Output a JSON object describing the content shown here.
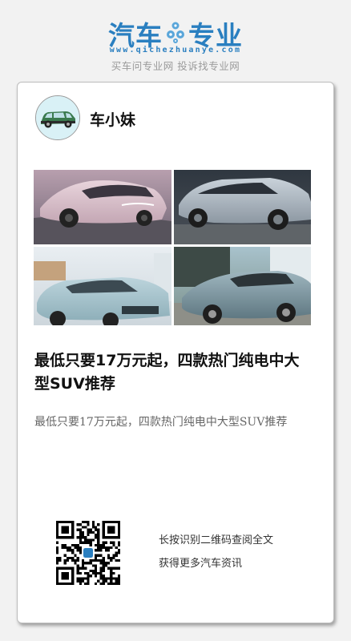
{
  "header": {
    "logo_left": "汽车",
    "logo_right": "专业",
    "logo_icon": "gear-icon",
    "site_url": "www.qichezhuanye.com",
    "slogan": "买车问专业网 投诉找专业网",
    "brand_color": "#2a7fc0"
  },
  "author": {
    "name": "车小妹",
    "avatar_icon": "car-avatar-icon"
  },
  "photos": [
    {
      "name": "pink-suv-photo"
    },
    {
      "name": "silver-suv-photo"
    },
    {
      "name": "light-blue-suv-photo"
    },
    {
      "name": "green-grey-suv-photo"
    }
  ],
  "article": {
    "title": "最低只要17万元起，四款热门纯电中大型SUV推荐",
    "summary": "最低只要17万元起，四款热门纯电中大型SUV推荐"
  },
  "qr": {
    "line1": "长按识别二维码查阅全文",
    "line2": "获得更多汽车资讯"
  }
}
